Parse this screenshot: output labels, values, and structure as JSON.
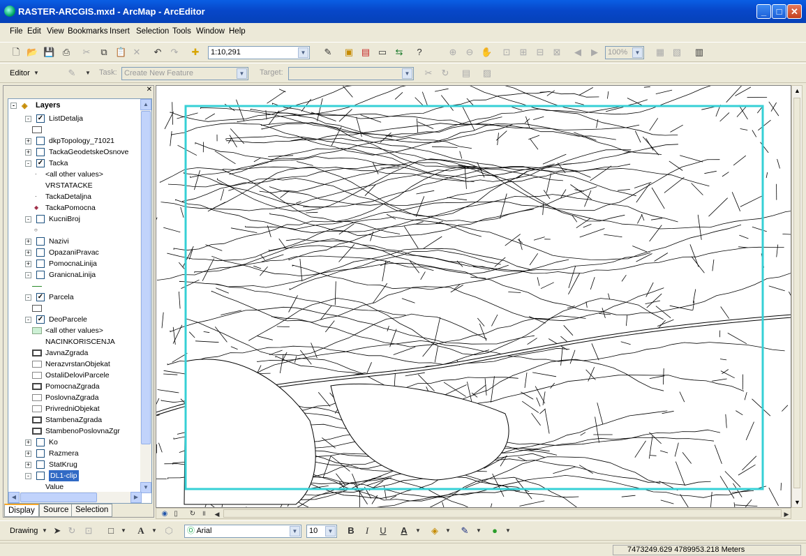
{
  "window": {
    "title": "RASTER-ARCGIS.mxd - ArcMap - ArcEditor",
    "minimize": "_",
    "maximize": "□",
    "close": "✕"
  },
  "menu": [
    "File",
    "Edit",
    "View",
    "Bookmarks",
    "Insert",
    "Selection",
    "Tools",
    "Window",
    "Help"
  ],
  "standard_toolbar": {
    "scale": "1:10,291",
    "zoom_pct": "100%"
  },
  "editor_toolbar": {
    "editor_label": "Editor",
    "task_label": "Task:",
    "task_value": "Create New Feature",
    "target_label": "Target:"
  },
  "toc": {
    "root": "Layers",
    "rows": [
      {
        "t": "-",
        "cb": "✓",
        "label": "ListDetalja"
      },
      {
        "sw": "box"
      },
      {
        "t": "+",
        "cb": "",
        "label": "dkpTopology_71021"
      },
      {
        "t": "+",
        "cb": "",
        "label": "TackaGeodetskeOsnove"
      },
      {
        "t": "-",
        "cb": "✓",
        "label": "Tacka"
      },
      {
        "sw": "dot",
        "label": "<all other values>"
      },
      {
        "label": "VRSTATACKE"
      },
      {
        "sw": "dot",
        "label": "TackaDetaljna"
      },
      {
        "sw": "diamond",
        "label": "TackaPomocna"
      },
      {
        "t": "-",
        "cb": "",
        "label": "KucniBroj"
      },
      {
        "sw": "circle"
      },
      {
        "t": "+",
        "cb": "",
        "label": "Nazivi"
      },
      {
        "t": "+",
        "cb": "",
        "label": "OpazaniPravac"
      },
      {
        "t": "+",
        "cb": "",
        "label": "PomocnaLinija"
      },
      {
        "t": "-",
        "cb": "",
        "label": "GranicnaLinija"
      },
      {
        "sw": "line"
      },
      {
        "t": "-",
        "cb": "✓",
        "label": "Parcela"
      },
      {
        "sw": "box"
      },
      {
        "t": "-",
        "cb": "✓",
        "label": "DeoParcele"
      },
      {
        "sw": "green",
        "label": "<all other values>"
      },
      {
        "label": "NACINKORISCENJA"
      },
      {
        "sw": "thick",
        "label": "JavnaZgrada"
      },
      {
        "sw": "thin",
        "label": "NerazvrstanObjekat"
      },
      {
        "sw": "thin",
        "label": "OstaliDeloviParcele"
      },
      {
        "sw": "thick",
        "label": "PomocnaZgrada"
      },
      {
        "sw": "thin",
        "label": "PoslovnaZgrada"
      },
      {
        "sw": "thin",
        "label": "PrivredniObjekat"
      },
      {
        "sw": "thick",
        "label": "StambenaZgrada"
      },
      {
        "sw": "thick",
        "label": "StambenoPoslovnaZgr"
      },
      {
        "t": "+",
        "cb": "",
        "label": "Ko"
      },
      {
        "t": "+",
        "cb": "",
        "label": "Razmera"
      },
      {
        "t": "+",
        "cb": "",
        "label": "StatKrug"
      },
      {
        "t": "-",
        "cb": "",
        "label": "DL1-clip",
        "selected": true
      },
      {
        "label": "Value"
      }
    ]
  },
  "toc_tabs": [
    "Display",
    "Source",
    "Selection"
  ],
  "drawing_toolbar": {
    "drawing_label": "Drawing",
    "font": "Arial",
    "size": "10",
    "bold": "B",
    "italic": "I",
    "underline": "U"
  },
  "status": {
    "coords": "7473249.629  4789953.218 Meters"
  },
  "colors": {
    "extent_frame": "#36d0d6",
    "titlebar": "#0747c9",
    "selection": "#316ac5"
  }
}
